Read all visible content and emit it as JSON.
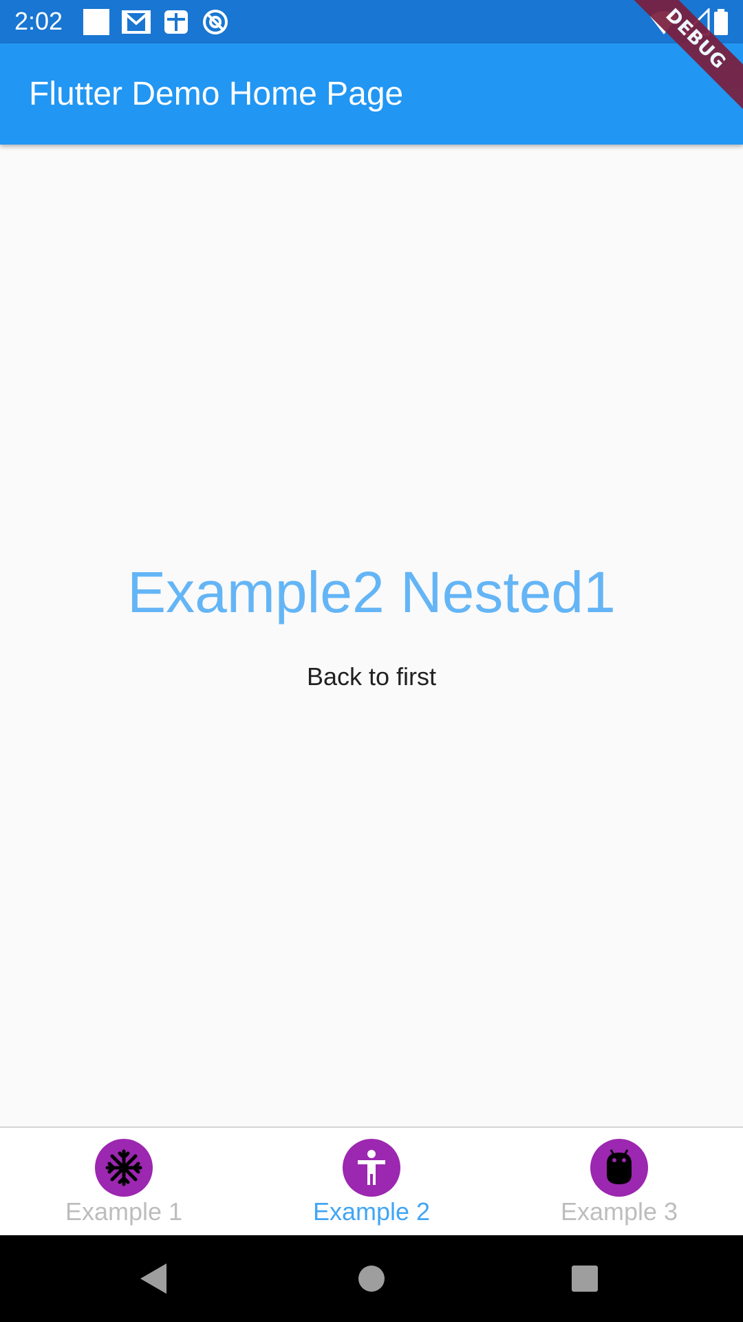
{
  "status_bar": {
    "time": "2:02",
    "icons": [
      "square-notification-icon",
      "gmail-icon",
      "app-notification-icon",
      "at-sign-icon",
      "wifi-icon",
      "signal-icon",
      "battery-icon"
    ],
    "color": "#1976d2"
  },
  "app_bar": {
    "title": "Flutter Demo Home Page",
    "color": "#2196f3"
  },
  "debug_banner": {
    "label": "DEBUG",
    "color": "#7a1f3d"
  },
  "main": {
    "heading": "Example2 Nested1",
    "heading_color": "#64b5f6",
    "back_button_label": "Back to first"
  },
  "bottom_nav": {
    "active_index": 1,
    "active_color": "#42a5f5",
    "inactive_color": "#bdbdbd",
    "icon_bg_color": "#9c27b0",
    "items": [
      {
        "label": "Example 1",
        "icon": "snowflake-icon"
      },
      {
        "label": "Example 2",
        "icon": "accessibility-icon"
      },
      {
        "label": "Example 3",
        "icon": "android-icon"
      }
    ]
  },
  "system_nav": {
    "buttons": [
      "back-triangle-icon",
      "home-circle-icon",
      "recents-square-icon"
    ]
  }
}
